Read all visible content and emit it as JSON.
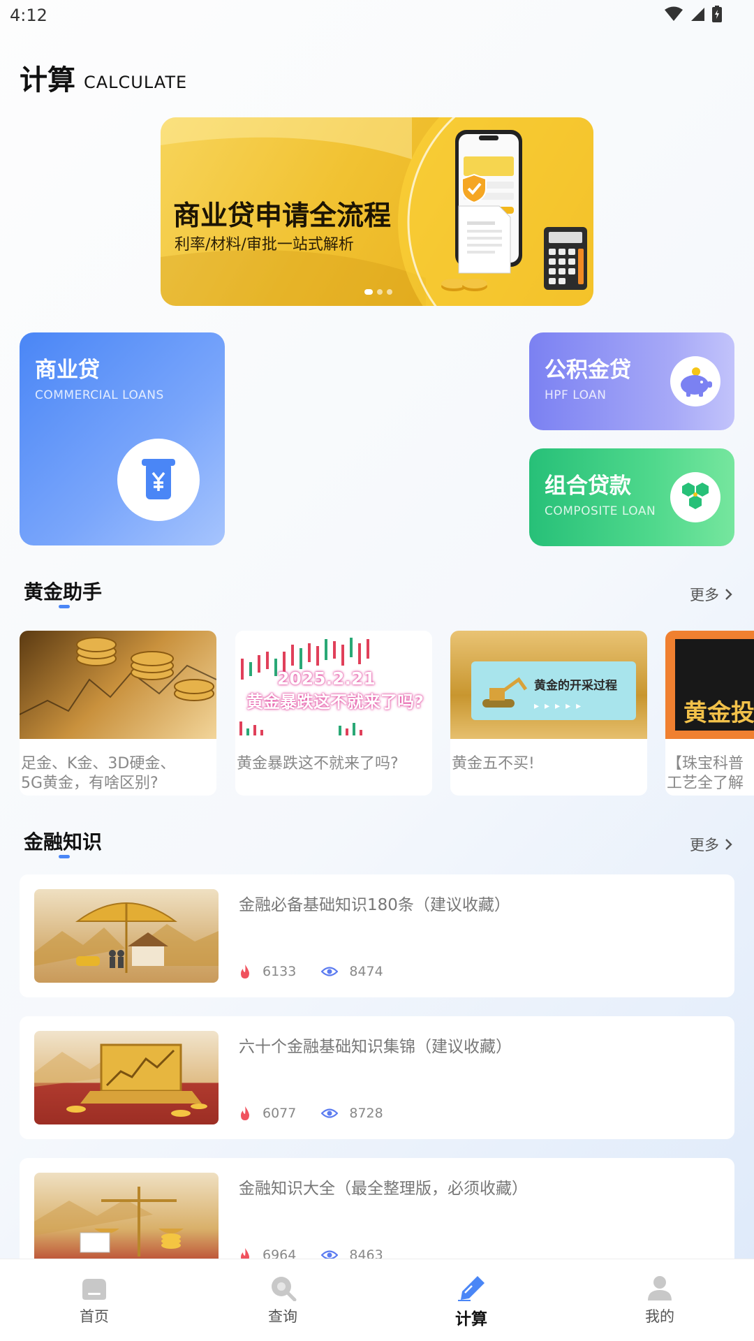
{
  "status_bar": {
    "time": "4:12"
  },
  "header": {
    "title": "计算",
    "subtitle": "CALCULATE"
  },
  "banner": {
    "title": "商业贷申请全流程",
    "subtitle": "利率/材料/审批一站式解析",
    "slide_count": 3,
    "active_slide": 1
  },
  "loan_cards": {
    "commercial": {
      "title": "商业贷",
      "subtitle": "COMMERCIAL LOANS",
      "icon": "yuan-atm-icon"
    },
    "hpf": {
      "title": "公积金贷",
      "subtitle": "HPF LOAN",
      "icon": "piggy-bank-icon"
    },
    "composite": {
      "title": "组合贷款",
      "subtitle": "COMPOSITE LOAN",
      "icon": "hexagon-cluster-icon"
    }
  },
  "gold_section": {
    "title": "黄金助手",
    "more": "更多",
    "items": [
      {
        "caption": "足金、K金、3D硬金、\n5G黄金，有啥区别?"
      },
      {
        "caption": "黄金暴跌这不就来了吗?",
        "thumb_text_1": "2025.2.21",
        "thumb_text_2": "黄金暴跌这不就来了吗?"
      },
      {
        "caption": "黄金五不买!",
        "thumb_text": "黄金的开采过程"
      },
      {
        "caption": "【珠宝科普\n工艺全了解",
        "thumb_text": "黄金投"
      }
    ]
  },
  "finance_section": {
    "title": "金融知识",
    "more": "更多",
    "items": [
      {
        "title": "金融必备基础知识180条（建议收藏）",
        "likes": "6133",
        "views": "8474"
      },
      {
        "title": "六十个金融基础知识集锦（建议收藏）",
        "likes": "6077",
        "views": "8728"
      },
      {
        "title": "金融知识大全（最全整理版，必须收藏）",
        "likes": "6964",
        "views": "8463"
      }
    ]
  },
  "tab_bar": {
    "tabs": [
      {
        "label": "首页",
        "icon": "home-icon"
      },
      {
        "label": "查询",
        "icon": "search-icon"
      },
      {
        "label": "计算",
        "icon": "pen-icon",
        "active": true
      },
      {
        "label": "我的",
        "icon": "user-icon"
      }
    ]
  },
  "colors": {
    "accent_blue": "#4a86f6",
    "hpf_purple": "#7b81f2",
    "composite_green": "#27c078",
    "banner_gold": "#f1c232"
  }
}
